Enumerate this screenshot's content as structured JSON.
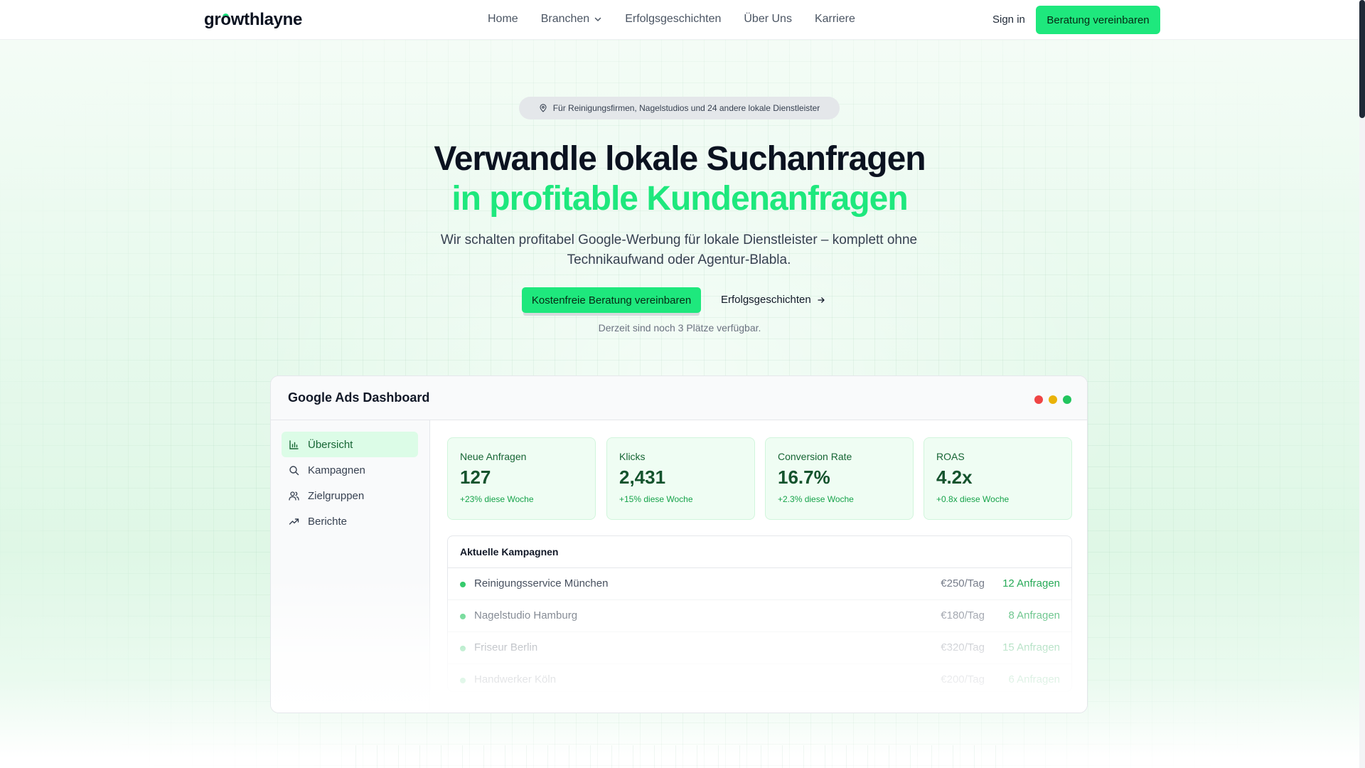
{
  "nav": {
    "logo": "growthlayne",
    "links": [
      "Home",
      "Branchen",
      "Erfolgsgeschichten",
      "Über Uns",
      "Karriere"
    ],
    "signin": "Sign in",
    "cta": "Beratung vereinbaren"
  },
  "hero": {
    "pill": "Für Reinigungsfirmen, Nagelstudios und 24 andere lokale Dienstleister",
    "title_line1": "Verwandle lokale Suchanfragen",
    "title_line2": "in profitable Kundenanfragen",
    "subtitle": "Wir schalten profitabel Google-Werbung für lokale Dienstleister – komplett ohne Technikaufwand oder Agentur-Blabla.",
    "cta_primary": "Kostenfreie Beratung vereinbaren",
    "cta_secondary": "Erfolgsgeschichten",
    "availability": "Derzeit sind noch 3 Plätze verfügbar."
  },
  "dashboard": {
    "title": "Google Ads Dashboard",
    "sidebar": [
      {
        "label": "Übersicht",
        "icon": "bar-chart-icon",
        "active": true
      },
      {
        "label": "Kampagnen",
        "icon": "search-icon",
        "active": false
      },
      {
        "label": "Zielgruppen",
        "icon": "users-icon",
        "active": false
      },
      {
        "label": "Berichte",
        "icon": "trending-up-icon",
        "active": false
      }
    ],
    "stats": [
      {
        "label": "Neue Anfragen",
        "value": "127",
        "delta": "+23% diese Woche"
      },
      {
        "label": "Klicks",
        "value": "2,431",
        "delta": "+15% diese Woche"
      },
      {
        "label": "Conversion Rate",
        "value": "16.7%",
        "delta": "+2.3% diese Woche"
      },
      {
        "label": "ROAS",
        "value": "4.2x",
        "delta": "+0.8x diese Woche"
      }
    ],
    "campaigns_title": "Aktuelle Kampagnen",
    "campaigns": [
      {
        "name": "Reinigungsservice München",
        "budget": "€250/Tag",
        "requests": "12 Anfragen"
      },
      {
        "name": "Nagelstudio Hamburg",
        "budget": "€180/Tag",
        "requests": "8 Anfragen"
      },
      {
        "name": "Friseur Berlin",
        "budget": "€320/Tag",
        "requests": "15 Anfragen"
      },
      {
        "name": "Handwerker Köln",
        "budget": "€200/Tag",
        "requests": "6 Anfragen"
      }
    ]
  },
  "colors": {
    "accent": "#1ee87d",
    "heading": "#0b1220",
    "stat_bg": "#effdf3",
    "window_red": "#ef4444",
    "window_yellow": "#eab308",
    "window_green": "#22c55e"
  }
}
